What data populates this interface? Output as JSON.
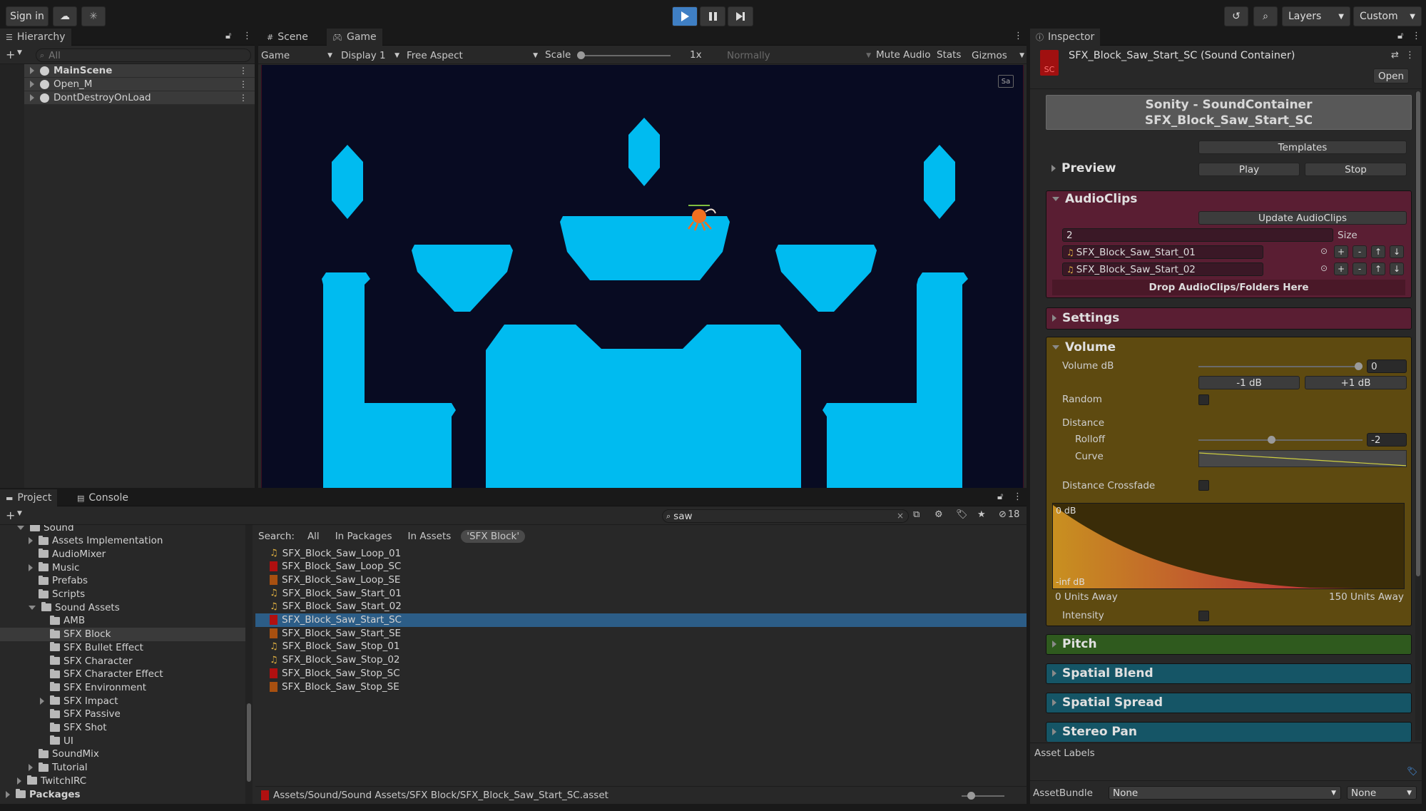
{
  "toolbar": {
    "sign_in": "Sign in",
    "layers": "Layers",
    "layout": "Custom"
  },
  "hierarchy": {
    "tab": "Hierarchy",
    "search_placeholder": "All",
    "items": [
      "MainScene",
      "Open_M",
      "DontDestroyOnLoad"
    ]
  },
  "view": {
    "tab_scene": "Scene",
    "tab_game": "Game",
    "mode": "Game",
    "display": "Display 1",
    "aspect": "Free Aspect",
    "scale_label": "Scale",
    "scale_value": "1x",
    "scale_fraction": 0.0,
    "vsync": "Normally",
    "mute": "Mute Audio",
    "stats": "Stats",
    "gizmos": "Gizmos"
  },
  "game_view": {
    "background": "#080b22",
    "platform_color": "#00bbf0",
    "character_color": "#f07020",
    "corner_label": "Sa"
  },
  "project": {
    "tab_project": "Project",
    "tab_console": "Console",
    "search_value": "saw",
    "hidden_count": "18",
    "search_label": "Search:",
    "filters": [
      "All",
      "In Packages",
      "In Assets",
      "'SFX Block'"
    ],
    "tree": [
      {
        "label": "Sound",
        "depth": 1,
        "arrow": "down"
      },
      {
        "label": "Assets Implementation",
        "depth": 2,
        "arrow": "right"
      },
      {
        "label": "AudioMixer",
        "depth": 2,
        "arrow": ""
      },
      {
        "label": "Music",
        "depth": 2,
        "arrow": "right"
      },
      {
        "label": "Prefabs",
        "depth": 2,
        "arrow": ""
      },
      {
        "label": "Scripts",
        "depth": 2,
        "arrow": ""
      },
      {
        "label": "Sound Assets",
        "depth": 2,
        "arrow": "down"
      },
      {
        "label": "AMB",
        "depth": 3,
        "arrow": ""
      },
      {
        "label": "SFX Block",
        "depth": 3,
        "arrow": "",
        "selected": true
      },
      {
        "label": "SFX Bullet Effect",
        "depth": 3,
        "arrow": ""
      },
      {
        "label": "SFX Character",
        "depth": 3,
        "arrow": ""
      },
      {
        "label": "SFX Character Effect",
        "depth": 3,
        "arrow": ""
      },
      {
        "label": "SFX Environment",
        "depth": 3,
        "arrow": ""
      },
      {
        "label": "SFX Impact",
        "depth": 3,
        "arrow": "right"
      },
      {
        "label": "SFX Passive",
        "depth": 3,
        "arrow": ""
      },
      {
        "label": "SFX Shot",
        "depth": 3,
        "arrow": ""
      },
      {
        "label": "UI",
        "depth": 3,
        "arrow": ""
      },
      {
        "label": "SoundMix",
        "depth": 2,
        "arrow": ""
      },
      {
        "label": "Tutorial",
        "depth": 2,
        "arrow": "right"
      },
      {
        "label": "TwitchIRC",
        "depth": 1,
        "arrow": "right"
      },
      {
        "label": "Packages",
        "depth": 0,
        "arrow": "right",
        "bold": true
      }
    ],
    "files": [
      {
        "name": "SFX_Block_Saw_Loop_01",
        "kind": "audio"
      },
      {
        "name": "SFX_Block_Saw_Loop_SC",
        "kind": "sc"
      },
      {
        "name": "SFX_Block_Saw_Loop_SE",
        "kind": "se"
      },
      {
        "name": "SFX_Block_Saw_Start_01",
        "kind": "audio"
      },
      {
        "name": "SFX_Block_Saw_Start_02",
        "kind": "audio"
      },
      {
        "name": "SFX_Block_Saw_Start_SC",
        "kind": "sc",
        "selected": true
      },
      {
        "name": "SFX_Block_Saw_Start_SE",
        "kind": "se"
      },
      {
        "name": "SFX_Block_Saw_Stop_01",
        "kind": "audio"
      },
      {
        "name": "SFX_Block_Saw_Stop_02",
        "kind": "audio"
      },
      {
        "name": "SFX_Block_Saw_Stop_SC",
        "kind": "sc"
      },
      {
        "name": "SFX_Block_Saw_Stop_SE",
        "kind": "se"
      }
    ],
    "path": "Assets/Sound/Sound Assets/SFX Block/SFX_Block_Saw_Start_SC.asset"
  },
  "inspector": {
    "tab": "Inspector",
    "object_title": "SFX_Block_Saw_Start_SC (Sound Container)",
    "open": "Open",
    "icon_text": "SC",
    "banner_line1": "Sonity - SoundContainer",
    "banner_line2": "SFX_Block_Saw_Start_SC",
    "templates": "Templates",
    "preview": "Preview",
    "play": "Play",
    "stop": "Stop",
    "audioclips": {
      "title": "AudioClips",
      "update": "Update AudioClips",
      "count": "2",
      "size_label": "Size",
      "clips": [
        "SFX_Block_Saw_Start_01",
        "SFX_Block_Saw_Start_02"
      ],
      "row_buttons": [
        "+",
        "-",
        "↑",
        "↓"
      ],
      "drop": "Drop AudioClips/Folders Here",
      "color": "#5a1e33"
    },
    "settings": {
      "title": "Settings",
      "color": "#5a1e33"
    },
    "volume": {
      "title": "Volume",
      "color": "#5e4a10",
      "volume_db_label": "Volume dB",
      "volume_db_value": "0",
      "minus_db": "-1 dB",
      "plus_db": "+1 dB",
      "random_label": "Random",
      "distance_label": "Distance",
      "rolloff_label": "Rolloff",
      "rolloff_value": "-2",
      "curve_label": "Curve",
      "crossfade_label": "Distance Crossfade",
      "graph_top": "0 dB",
      "graph_bottom": "-inf dB",
      "graph_left": "0 Units Away",
      "graph_right": "150 Units Away",
      "intensity_label": "Intensity"
    },
    "pitch": {
      "title": "Pitch",
      "color": "#2f5a1e"
    },
    "spatial_blend": {
      "title": "Spatial Blend",
      "color": "#155566"
    },
    "spatial_spread": {
      "title": "Spatial Spread",
      "color": "#155566"
    },
    "stereo_pan": {
      "title": "Stereo Pan",
      "color": "#155566"
    },
    "asset_labels": "Asset Labels",
    "assetbundle_label": "AssetBundle",
    "assetbundle_value": "None",
    "variant_value": "None"
  }
}
